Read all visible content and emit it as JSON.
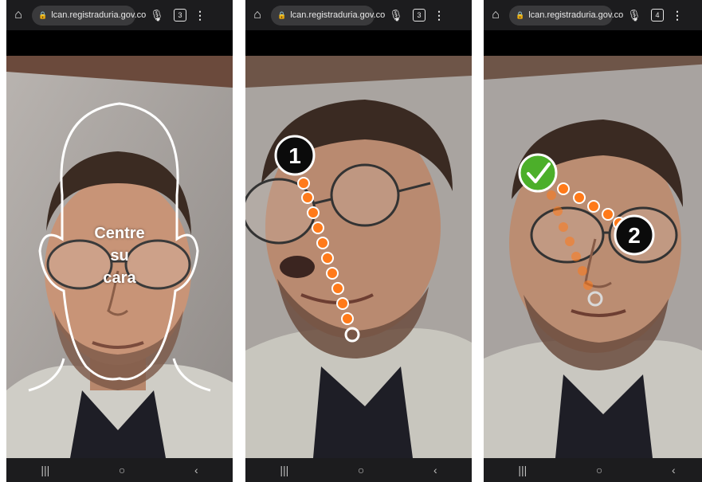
{
  "panels": [
    {
      "url": "lcan.registraduria.gov.co",
      "tab_count": "3",
      "overlay_lines": [
        "Centre",
        "su",
        "cara"
      ]
    },
    {
      "url": "lcan.registraduria.gov.co",
      "tab_count": "3",
      "step_label": "1"
    },
    {
      "url": "lcan.registraduria.gov.co",
      "tab_count": "4",
      "step_label": "2"
    }
  ],
  "icons": {
    "home": "home-icon",
    "lock": "lock-icon",
    "mic": "mic-icon",
    "tabs": "tabs-icon",
    "menu": "more-vert-icon",
    "nav_recent": "recent-apps-icon",
    "nav_home": "nav-home-icon",
    "nav_back": "back-icon",
    "check": "check-icon"
  },
  "colors": {
    "dot_orange": "#ff7a1a",
    "check_green": "#4caf2a",
    "badge_black": "#0b0b0b"
  }
}
